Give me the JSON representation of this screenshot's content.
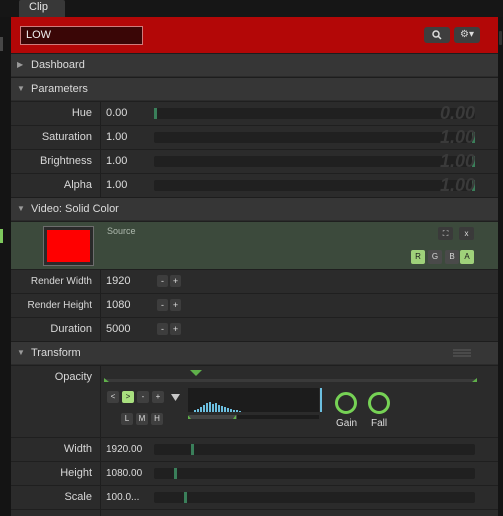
{
  "tabs": [
    {
      "label": "Clip"
    }
  ],
  "search": {
    "value": "LOW",
    "icon": "search-icon",
    "settings_icon": "gear-icon"
  },
  "sections": {
    "dashboard": {
      "title": "Dashboard"
    },
    "parameters": {
      "title": "Parameters"
    },
    "video": {
      "title": "Video: Solid Color"
    },
    "transform": {
      "title": "Transform"
    }
  },
  "parameters": [
    {
      "label": "Hue",
      "value": "0.00",
      "ghost": "0.00",
      "level": 0.0
    },
    {
      "label": "Saturation",
      "value": "1.00",
      "ghost": "1.00",
      "level": 1.0
    },
    {
      "label": "Brightness",
      "value": "1.00",
      "ghost": "1.00",
      "level": 1.0
    },
    {
      "label": "Alpha",
      "value": "1.00",
      "ghost": "1.00",
      "level": 1.0
    }
  ],
  "video": {
    "source_label": "Source",
    "color": "#ff0000",
    "close": "x",
    "channels": [
      {
        "label": "R",
        "active": true
      },
      {
        "label": "G",
        "active": false
      },
      {
        "label": "B",
        "active": false
      },
      {
        "label": "A",
        "active": true
      }
    ],
    "rows": [
      {
        "label": "Render Width",
        "value": "1920"
      },
      {
        "label": "Render Height",
        "value": "1080"
      },
      {
        "label": "Duration",
        "value": "5000"
      }
    ],
    "stepper": {
      "minus": "-",
      "plus": "+"
    }
  },
  "transform": {
    "opacity_label": "Opacity",
    "nav": {
      "prev": "<",
      "next": ">",
      "minus": "-",
      "plus": "+"
    },
    "lmh": [
      "L",
      "M",
      "H"
    ],
    "gain_label": "Gain",
    "fall_label": "Fall",
    "rows": [
      {
        "label": "Width",
        "value": "1920.00"
      },
      {
        "label": "Height",
        "value": "1080.00"
      },
      {
        "label": "Scale",
        "value": "100.0..."
      }
    ]
  },
  "colors": {
    "accent_red": "#b30707",
    "accent_green": "#76d255",
    "panel": "#2b2b2b"
  }
}
